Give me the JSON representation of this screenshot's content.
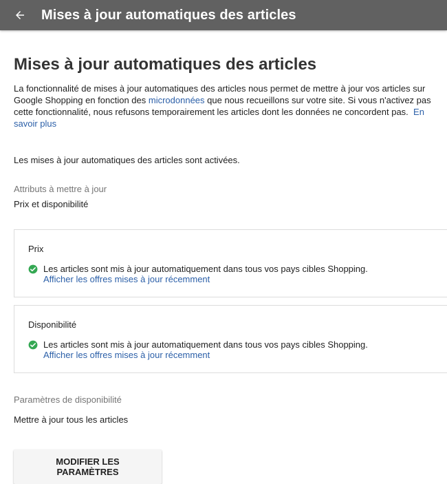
{
  "header": {
    "title": "Mises à jour automatiques des articles"
  },
  "page": {
    "title": "Mises à jour automatiques des articles",
    "description_part1": "La fonctionnalité de mises à jour automatiques des articles nous permet de mettre à jour vos articles sur Google Shopping en fonction des ",
    "description_link1": "microdonnées",
    "description_part2": " que nous recueillons sur votre site. Si vous n'activez pas cette fonctionnalité, nous refusons temporairement les articles dont les données ne concordent pas.",
    "description_link2": "En savoir plus",
    "status": "Les mises à jour automatiques des articles sont activées.",
    "attributes_label": "Attributs à mettre à jour",
    "attributes_value": "Prix et disponibilité"
  },
  "cards": [
    {
      "title": "Prix",
      "text": "Les articles sont mis à jour automatiquement dans tous vos pays cibles Shopping.",
      "link": "Afficher les offres mises à jour récemment"
    },
    {
      "title": "Disponibilité",
      "text": "Les articles sont mis à jour automatiquement dans tous vos pays cibles Shopping.",
      "link": "Afficher les offres mises à jour récemment"
    }
  ],
  "availability": {
    "label": "Paramètres de disponibilité",
    "value": "Mettre à jour tous les articles"
  },
  "actions": {
    "modify_label": "MODIFIER LES PARAMÈTRES"
  },
  "colors": {
    "header_bg": "#616161",
    "link": "#2b5fa8",
    "check": "#34a853"
  }
}
